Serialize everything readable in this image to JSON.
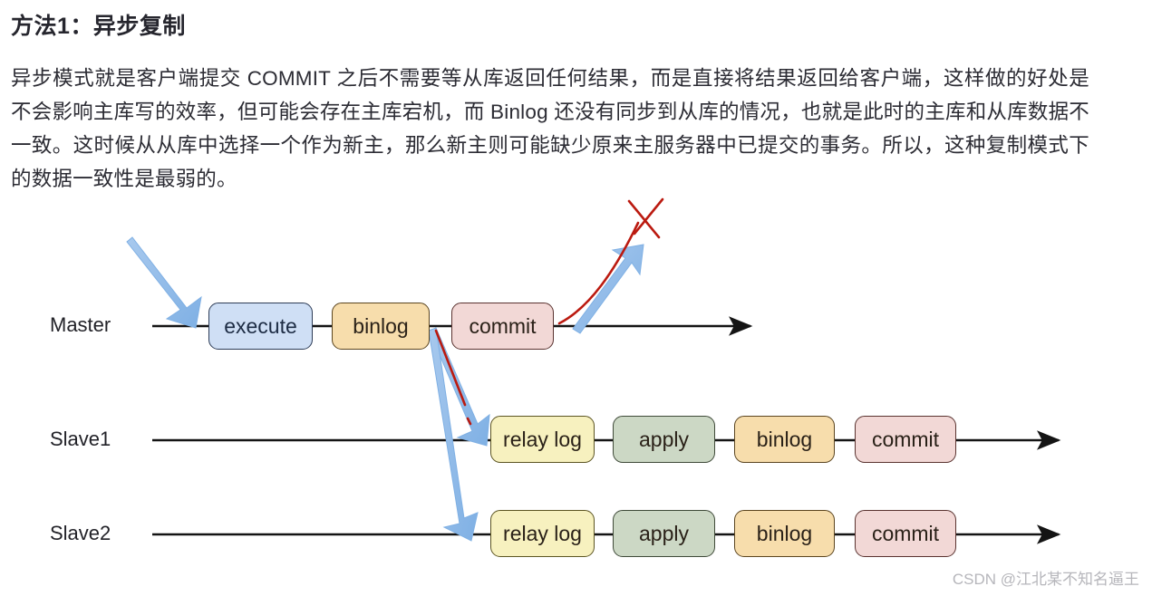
{
  "article": {
    "title": "方法1：异步复制",
    "paragraph": "异步模式就是客户端提交 COMMIT 之后不需要等从库返回任何结果，而是直接将结果返回给客户端，这样做的好处是不会影响主库写的效率，但可能会存在主库宕机，而 Binlog 还没有同步到从库的情况，也就是此时的主库和从库数据不一致。这时候从从库中选择一个作为新主，那么新主则可能缺少原来主服务器中已提交的事务。所以，这种复制模式下的数据一致性是最弱的。"
  },
  "diagram": {
    "rows": [
      {
        "label": "Master",
        "nodes": [
          {
            "text": "execute",
            "kind": "execute"
          },
          {
            "text": "binlog",
            "kind": "binlog"
          },
          {
            "text": "commit",
            "kind": "commit"
          }
        ]
      },
      {
        "label": "Slave1",
        "nodes": [
          {
            "text": "relay log",
            "kind": "relay"
          },
          {
            "text": "apply",
            "kind": "apply"
          },
          {
            "text": "binlog",
            "kind": "binlog"
          },
          {
            "text": "commit",
            "kind": "commit"
          }
        ]
      },
      {
        "label": "Slave2",
        "nodes": [
          {
            "text": "relay log",
            "kind": "relay"
          },
          {
            "text": "apply",
            "kind": "apply"
          },
          {
            "text": "binlog",
            "kind": "binlog"
          },
          {
            "text": "commit",
            "kind": "commit"
          }
        ]
      }
    ],
    "annotations": {
      "incoming_arrow": "blue-arrow-into-master",
      "replication_arrow_slave1": "blue-arrow-to-slave1-relay-log",
      "replication_arrow_slave2": "blue-arrow-to-slave2-relay-log",
      "return_arrow": "blue-arrow-commit-returns-to-client",
      "red_mark": "red-curve-with-x-mark"
    },
    "colors": {
      "execute": "#cfdff5",
      "binlog": "#f7ddac",
      "commit": "#f2d8d6",
      "relay": "#f7f1bf",
      "apply": "#ccd8c5",
      "annotation_blue": "#8ab6e8",
      "annotation_red": "#c00000",
      "timeline": "#141414"
    }
  },
  "watermark": "CSDN @江北某不知名逼王"
}
